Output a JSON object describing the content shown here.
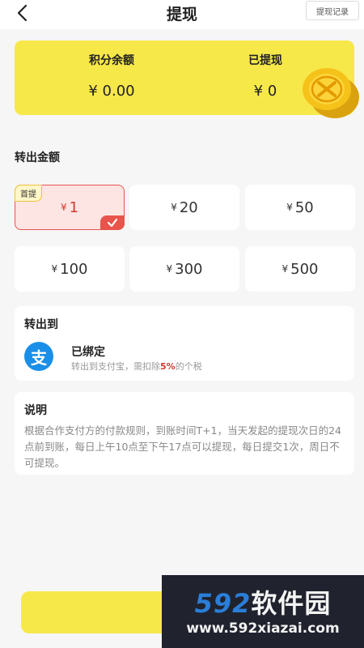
{
  "header": {
    "title": "提现",
    "record_label": "提现记录"
  },
  "balance": {
    "points_label": "积分余额",
    "points_value": "¥ 0.00",
    "withdrawn_label": "已提现",
    "withdrawn_value": "¥ 0"
  },
  "amount_section": {
    "title": "转出金额",
    "first_badge": "首提",
    "currency": "¥",
    "options": [
      "1",
      "20",
      "50",
      "100",
      "300",
      "500"
    ],
    "selected_index": 0
  },
  "transfer": {
    "title": "转出到",
    "icon_glyph": "支",
    "status": "已绑定",
    "desc_prefix": "转出到支付宝，需扣除",
    "desc_pct": "5%",
    "desc_suffix": "的个税"
  },
  "notes": {
    "title": "说明",
    "text": "根据合作支付方的付款规则，到账时间T+1，当天发起的提现次日的24点前到账，每日上午10点至下午17点可以提现，每日提交1次，周日不可提现。"
  },
  "watermark": {
    "logo_num": "592",
    "logo_cn": "软件园",
    "url": "www.592xiazai.com"
  },
  "colors": {
    "accent_yellow": "#f7e84a",
    "selected_red": "#e8544b",
    "alipay_blue": "#1a8fe8"
  }
}
